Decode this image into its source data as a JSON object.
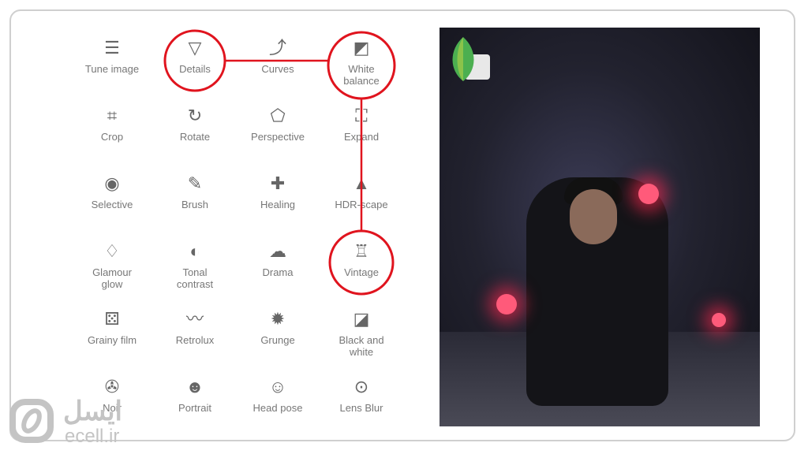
{
  "tools": [
    {
      "label": "Tune image",
      "icon": "sliders-icon",
      "glyph": "☰"
    },
    {
      "label": "Details",
      "icon": "triangle-down-icon",
      "glyph": "▽"
    },
    {
      "label": "Curves",
      "icon": "curves-icon",
      "glyph": "⤴"
    },
    {
      "label": "White balance",
      "icon": "white-balance-icon",
      "glyph": "◩"
    },
    {
      "label": "Crop",
      "icon": "crop-icon",
      "glyph": "⌗"
    },
    {
      "label": "Rotate",
      "icon": "rotate-icon",
      "glyph": "↻"
    },
    {
      "label": "Perspective",
      "icon": "perspective-icon",
      "glyph": "⬠"
    },
    {
      "label": "Expand",
      "icon": "expand-icon",
      "glyph": "⛶"
    },
    {
      "label": "Selective",
      "icon": "selective-icon",
      "glyph": "◉"
    },
    {
      "label": "Brush",
      "icon": "brush-icon",
      "glyph": "✎"
    },
    {
      "label": "Healing",
      "icon": "healing-icon",
      "glyph": "✚"
    },
    {
      "label": "HDR-scape",
      "icon": "mountain-icon",
      "glyph": "▲"
    },
    {
      "label": "Glamour glow",
      "icon": "diamond-icon",
      "glyph": "♢"
    },
    {
      "label": "Tonal contrast",
      "icon": "tonal-contrast-icon",
      "glyph": "◐"
    },
    {
      "label": "Drama",
      "icon": "cloud-icon",
      "glyph": "☁"
    },
    {
      "label": "Vintage",
      "icon": "lamp-icon",
      "glyph": "♖"
    },
    {
      "label": "Grainy film",
      "icon": "grain-icon",
      "glyph": "⚄"
    },
    {
      "label": "Retrolux",
      "icon": "mustache-icon",
      "glyph": "〰"
    },
    {
      "label": "Grunge",
      "icon": "grunge-icon",
      "glyph": "✹"
    },
    {
      "label": "Black and white",
      "icon": "black-white-icon",
      "glyph": "◪"
    },
    {
      "label": "Noir",
      "icon": "film-reel-icon",
      "glyph": "✇"
    },
    {
      "label": "Portrait",
      "icon": "face-icon",
      "glyph": "☻"
    },
    {
      "label": "Head pose",
      "icon": "head-pose-icon",
      "glyph": "☺"
    },
    {
      "label": "Lens Blur",
      "icon": "lens-blur-icon",
      "glyph": "⊙"
    }
  ],
  "highlight_color": "#e0141e",
  "highlighted": [
    "Details",
    "White balance",
    "Vintage"
  ],
  "watermark": {
    "persian": "ایسل",
    "latin": "ecell.ir"
  }
}
